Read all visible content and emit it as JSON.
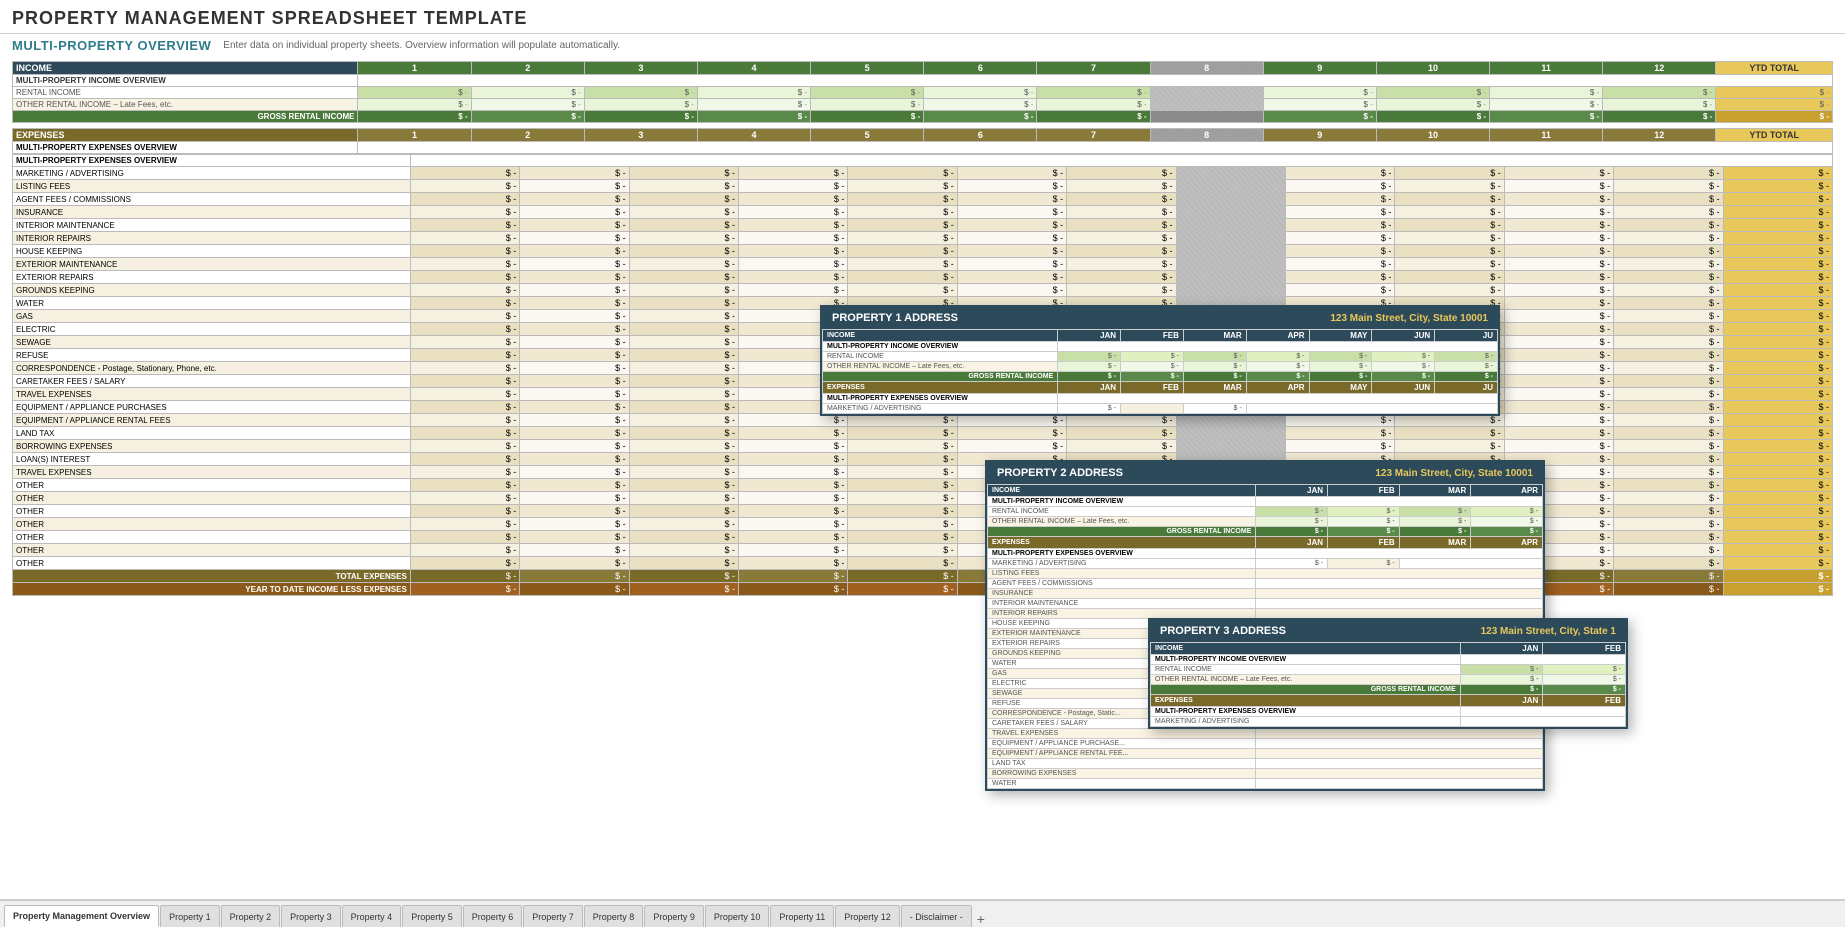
{
  "app": {
    "title": "PROPERTY MANAGEMENT SPREADSHEET TEMPLATE",
    "section_title": "MULTI-PROPERTY OVERVIEW",
    "section_subtitle": "Enter data on individual property sheets.  Overview information will populate automatically."
  },
  "columns": {
    "income_header": "INCOME",
    "expenses_header": "EXPENSES",
    "numbers": [
      "1",
      "2",
      "3",
      "4",
      "5",
      "6",
      "7",
      "8",
      "9",
      "10",
      "11",
      "12"
    ],
    "ytd": "YTD TOTAL"
  },
  "income_rows": [
    {
      "label": "MULTI-PROPERTY INCOME OVERVIEW",
      "type": "section"
    },
    {
      "label": "RENTAL INCOME",
      "type": "data"
    },
    {
      "label": "OTHER RENTAL INCOME – Late Fees, etc.",
      "type": "data-alt"
    },
    {
      "label": "GROSS RENTAL INCOME",
      "type": "gross"
    }
  ],
  "expense_rows": [
    {
      "label": "MULTI-PROPERTY EXPENSES OVERVIEW",
      "type": "section"
    },
    {
      "label": "MARKETING / ADVERTISING",
      "type": "data"
    },
    {
      "label": "LISTING FEES",
      "type": "data-alt"
    },
    {
      "label": "AGENT FEES / COMMISSIONS",
      "type": "data"
    },
    {
      "label": "INSURANCE",
      "type": "data-alt"
    },
    {
      "label": "INTERIOR MAINTENANCE",
      "type": "data"
    },
    {
      "label": "INTERIOR REPAIRS",
      "type": "data-alt"
    },
    {
      "label": "HOUSE KEEPING",
      "type": "data"
    },
    {
      "label": "EXTERIOR MAINTENANCE",
      "type": "data-alt"
    },
    {
      "label": "EXTERIOR REPAIRS",
      "type": "data"
    },
    {
      "label": "GROUNDS KEEPING",
      "type": "data-alt"
    },
    {
      "label": "WATER",
      "type": "data"
    },
    {
      "label": "GAS",
      "type": "data-alt"
    },
    {
      "label": "ELECTRIC",
      "type": "data"
    },
    {
      "label": "SEWAGE",
      "type": "data-alt"
    },
    {
      "label": "REFUSE",
      "type": "data"
    },
    {
      "label": "CORRESPONDENCE - Postage, Stationary, Phone, etc.",
      "type": "data-alt"
    },
    {
      "label": "CARETAKER FEES / SALARY",
      "type": "data"
    },
    {
      "label": "TRAVEL EXPENSES",
      "type": "data-alt"
    },
    {
      "label": "EQUIPMENT / APPLIANCE PURCHASES",
      "type": "data"
    },
    {
      "label": "EQUIPMENT / APPLIANCE RENTAL FEES",
      "type": "data-alt"
    },
    {
      "label": "LAND TAX",
      "type": "data"
    },
    {
      "label": "BORROWING EXPENSES",
      "type": "data-alt"
    },
    {
      "label": "LOAN(S) INTEREST",
      "type": "data"
    },
    {
      "label": "TRAVEL EXPENSES",
      "type": "data-alt"
    },
    {
      "label": "OTHER",
      "type": "data"
    },
    {
      "label": "OTHER",
      "type": "data-alt"
    },
    {
      "label": "OTHER",
      "type": "data"
    },
    {
      "label": "OTHER",
      "type": "data-alt"
    },
    {
      "label": "OTHER",
      "type": "data"
    },
    {
      "label": "OTHER",
      "type": "data-alt"
    },
    {
      "label": "OTHER",
      "type": "data"
    },
    {
      "label": "TOTAL EXPENSES",
      "type": "total"
    },
    {
      "label": "YEAR TO DATE INCOME LESS EXPENSES",
      "type": "ytd"
    }
  ],
  "tabs": [
    {
      "label": "Property Management Overview",
      "active": true
    },
    {
      "label": "Property 1",
      "active": false
    },
    {
      "label": "Property 2",
      "active": false
    },
    {
      "label": "Property 3",
      "active": false
    },
    {
      "label": "Property 4",
      "active": false
    },
    {
      "label": "Property 5",
      "active": false
    },
    {
      "label": "Property 6",
      "active": false
    },
    {
      "label": "Property 7",
      "active": false
    },
    {
      "label": "Property 8",
      "active": false
    },
    {
      "label": "Property 9",
      "active": false
    },
    {
      "label": "Property 10",
      "active": false
    },
    {
      "label": "Property 11",
      "active": false
    },
    {
      "label": "Property 12",
      "active": false
    },
    {
      "label": "- Disclaimer -",
      "active": false
    }
  ],
  "popups": {
    "prop1": {
      "title": "PROPERTY 1 ADDRESS",
      "address": "123 Main Street, City, State  10001",
      "months": [
        "JAN",
        "FEB",
        "MAR",
        "APR",
        "MAY",
        "JUN",
        "JU"
      ]
    },
    "prop2": {
      "title": "PROPERTY 2 ADDRESS",
      "address": "123 Main Street, City, State  10001",
      "months": [
        "JAN",
        "FEB",
        "MAR",
        "APR"
      ]
    },
    "prop3": {
      "title": "PROPERTY 3 ADDRESS",
      "address": "123 Main Street, City, State  1",
      "months": [
        "JAN",
        "FEB"
      ]
    }
  }
}
